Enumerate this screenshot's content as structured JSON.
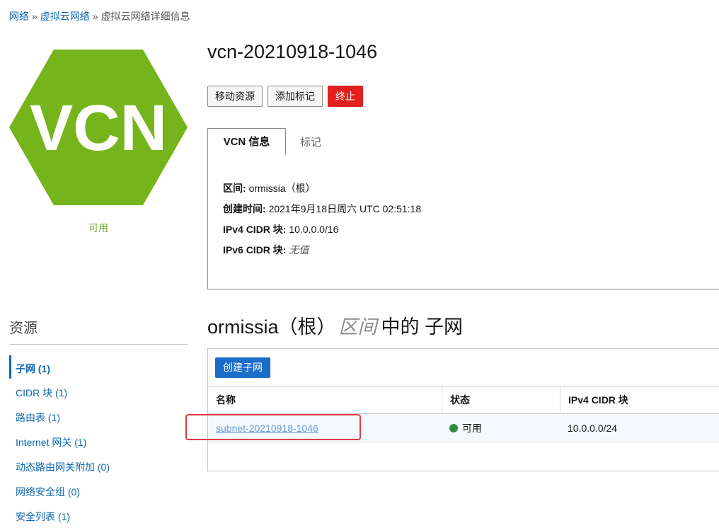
{
  "breadcrumb": {
    "items": [
      "网络",
      "虚拟云网络"
    ],
    "separator": "»",
    "current": "虚拟云网络详细信息"
  },
  "vcn_icon": {
    "text": "VCN",
    "color": "#76b41c"
  },
  "status": {
    "label": "可用",
    "color": "#6aaa2d"
  },
  "page_title": "vcn-20210918-1046",
  "actions": {
    "move": "移动资源",
    "add_tag": "添加标记",
    "terminate": "终止"
  },
  "tabs": {
    "active": "VCN 信息",
    "inactive": "标记"
  },
  "info": {
    "compartment_label": "区间:",
    "compartment_value": "ormissia（根）",
    "created_label": "创建时间:",
    "created_value": "2021年9月18日周六 UTC 02:51:18",
    "ipv4_label": "IPv4 CIDR 块:",
    "ipv4_value": "10.0.0.0/16",
    "ipv6_label": "IPv6 CIDR 块:",
    "ipv6_value": "无值"
  },
  "resources": {
    "title": "资源",
    "items": [
      "子网 (1)",
      "CIDR 块 (1)",
      "路由表 (1)",
      "Internet 网关 (1)",
      "动态路由网关附加 (0)",
      "网络安全组 (0)",
      "安全列表 (1)"
    ]
  },
  "subnets_section": {
    "compartment": "ormissia（根）",
    "compartment_word": "区间",
    "suffix": "中的 子网",
    "create_button": "创建子网",
    "columns": [
      "名称",
      "状态",
      "IPv4 CIDR 块"
    ],
    "rows": [
      {
        "name": "subnet-20210918-1046",
        "status": "可用",
        "cidr": "10.0.0.0/24"
      }
    ]
  },
  "colors": {
    "accent": "#0f68b0",
    "danger": "#e21f1f",
    "primary_button": "#1a6dc9",
    "status_ok": "#2e8b3a",
    "highlight": "#e03a47"
  }
}
